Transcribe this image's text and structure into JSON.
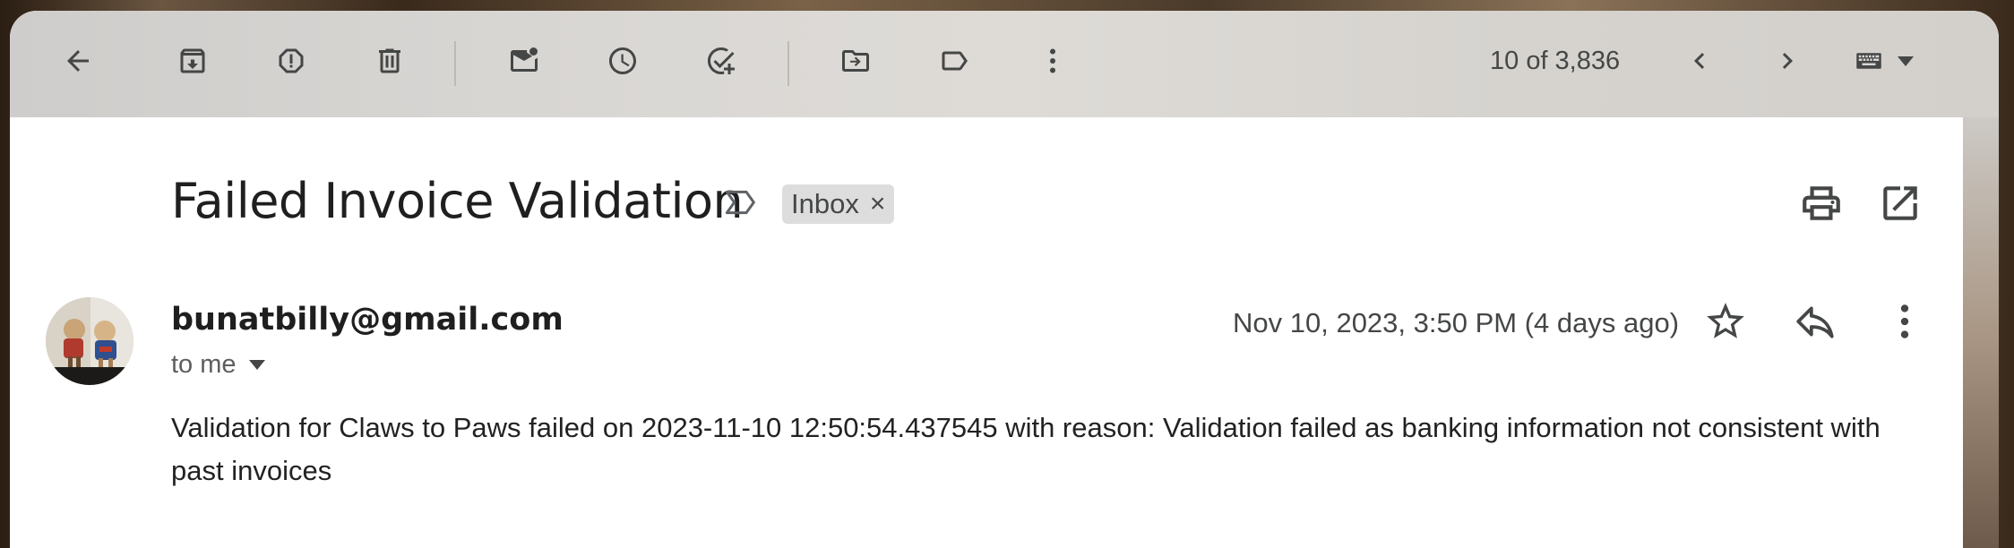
{
  "toolbar": {
    "buttons": [
      {
        "name": "back-button",
        "icon": "arrow-left-icon"
      },
      {
        "name": "archive-button",
        "icon": "archive-icon"
      },
      {
        "name": "report-spam-button",
        "icon": "report-spam-icon"
      },
      {
        "name": "delete-button",
        "icon": "trash-icon"
      },
      {
        "name": "mark-unread-button",
        "icon": "mark-unread-icon"
      },
      {
        "name": "snooze-button",
        "icon": "clock-icon"
      },
      {
        "name": "add-task-button",
        "icon": "add-task-icon"
      },
      {
        "name": "move-to-button",
        "icon": "folder-move-icon"
      },
      {
        "name": "labels-button",
        "icon": "label-icon"
      },
      {
        "name": "more-button",
        "icon": "more-vertical-icon"
      }
    ],
    "counter": "10 of 3,836",
    "input_tools_icon": "keyboard-icon"
  },
  "email": {
    "subject": "Failed Invoice Validation",
    "label": "Inbox",
    "label_remove": "×",
    "sender": "bunatbilly@gmail.com",
    "recipient": "to me",
    "date": "Nov 10, 2023, 3:50 PM (4 days ago)",
    "body": "Validation for Claws to Paws failed on 2023-11-10 12:50:54.437545 with reason: Validation failed as banking information not consistent with past invoices"
  },
  "colors": {
    "toolbar_bg": "#d8d6d3",
    "icon": "#444746",
    "text": "#1f1f1f",
    "chip_bg": "#dddddd"
  }
}
